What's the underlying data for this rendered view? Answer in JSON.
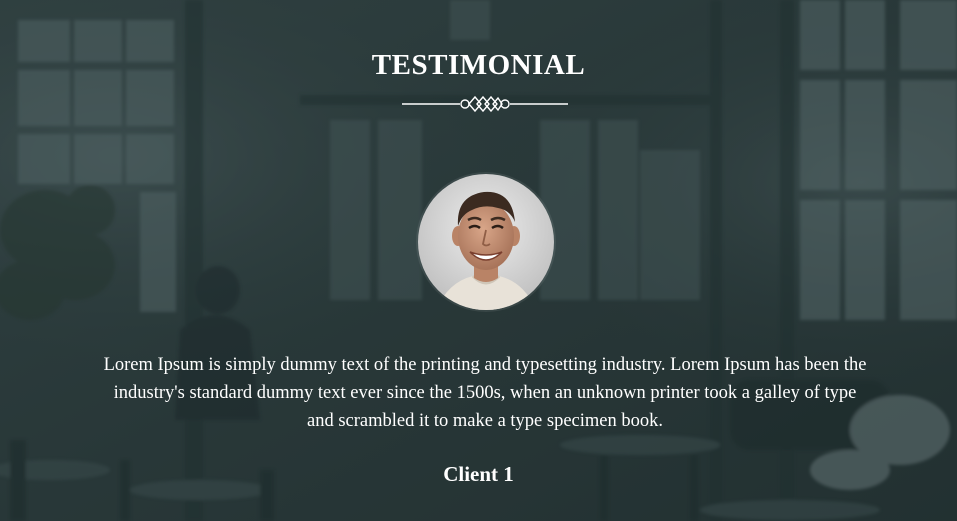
{
  "section": {
    "title": "TESTIMONIAL",
    "divider_icon": "ornament-knot-icon"
  },
  "testimonial": {
    "avatar_icon": "client-photo-avatar",
    "quote": "Lorem Ipsum is simply dummy text of the printing and typesetting industry. Lorem Ipsum has been the industry's standard dummy text ever since the 1500s, when an unknown printer took a galley of type and scrambled it to make a type specimen book.",
    "client_name": "Client 1"
  },
  "colors": {
    "background": "#2b3a3b",
    "text": "#ffffff"
  }
}
